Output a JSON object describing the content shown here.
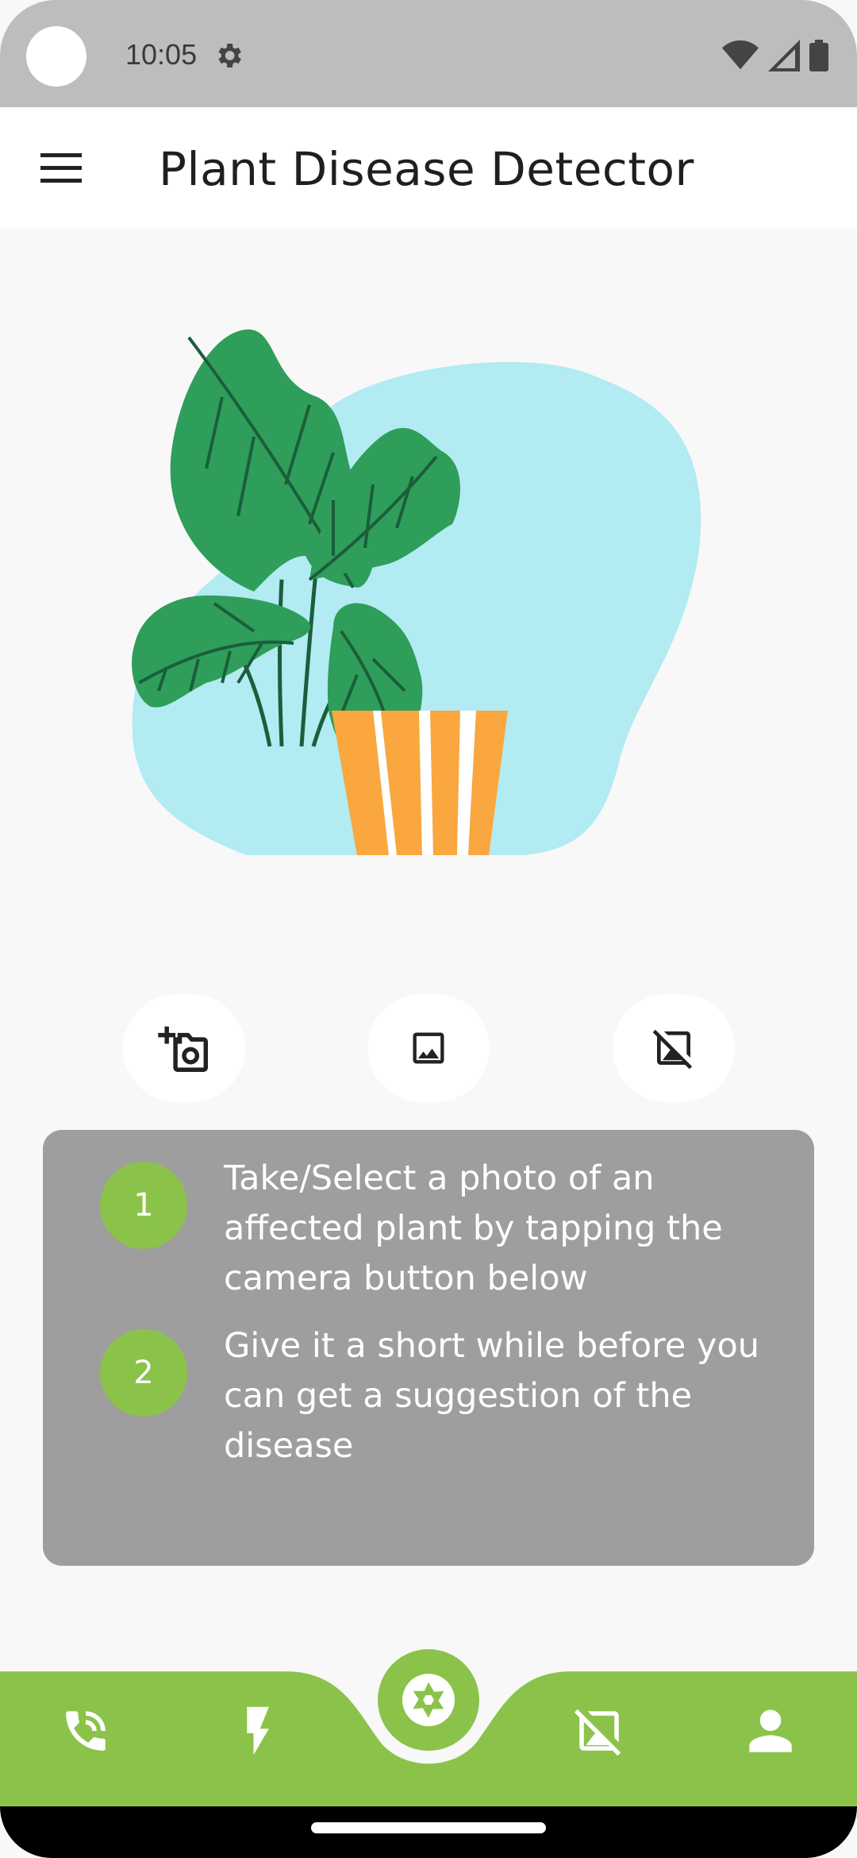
{
  "status_bar": {
    "time": "10:05",
    "icons": [
      "settings-icon",
      "wifi-icon",
      "signal-icon",
      "battery-icon"
    ]
  },
  "app_bar": {
    "title": "Plant Disease Detector",
    "menu_icon": "hamburger-menu-icon"
  },
  "illustration": {
    "subject": "potted-plant",
    "colors": {
      "blob": "#b2ebf2",
      "leaf": "#2e9e5a",
      "pot_stripe": "#f9a73e"
    }
  },
  "actions": [
    {
      "icon": "add-photo-camera-icon"
    },
    {
      "icon": "image-gallery-icon"
    },
    {
      "icon": "hide-image-icon"
    }
  ],
  "instructions": {
    "steps": [
      {
        "number": "1",
        "text": "Take/Select a photo of an affected plant by tapping the camera button below"
      },
      {
        "number": "2",
        "text": "Give it a short while before you can get a suggestion of the disease"
      }
    ]
  },
  "bottom_nav": {
    "items": [
      {
        "icon": "phone-call-icon"
      },
      {
        "icon": "flash-icon"
      },
      {
        "icon": "plant-disease-icon"
      },
      {
        "icon": "person-icon"
      }
    ],
    "center_icon": "camera-shutter-icon"
  },
  "colors": {
    "accent": "#8bc34a",
    "card": "#9e9e9e",
    "status_bar": "#bdbdbd"
  }
}
